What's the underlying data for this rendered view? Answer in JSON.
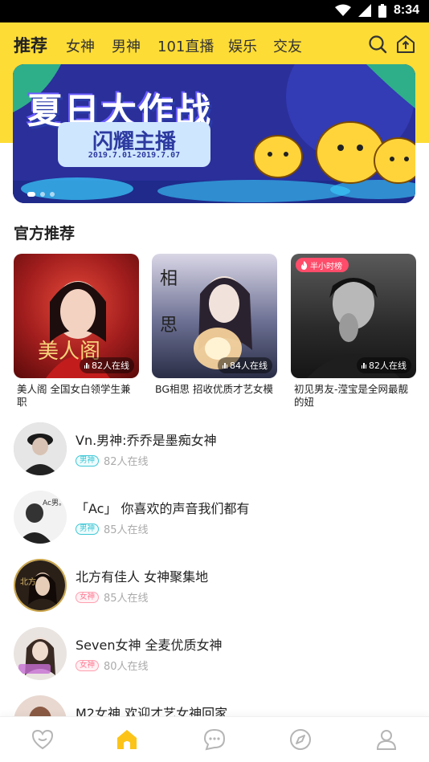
{
  "status_bar": {
    "time": "8:34"
  },
  "top_nav": {
    "tabs": [
      {
        "label": "推荐",
        "active": true
      },
      {
        "label": "女神",
        "active": false
      },
      {
        "label": "男神",
        "active": false
      },
      {
        "label": "101直播",
        "active": false
      },
      {
        "label": "娱乐",
        "active": false
      },
      {
        "label": "交友",
        "active": false
      }
    ],
    "icons": [
      "search-icon",
      "home-upload-icon"
    ]
  },
  "banner": {
    "title": "夏日大作战",
    "subtitle": "闪耀主播",
    "date_range": "2019.7.01-2019.7.07"
  },
  "official": {
    "title": "官方推荐",
    "cards": [
      {
        "title": "美人阁  全国女白领学生兼职",
        "online": "82人在线",
        "badge": ""
      },
      {
        "title": "BG相思   招收优质才艺女模",
        "online": "84人在线",
        "badge": ""
      },
      {
        "title": "初见男友-滢宝是全网最靓的妞",
        "online": "82人在线",
        "badge": "半小时榜"
      }
    ]
  },
  "rooms": [
    {
      "title": "Vn.男神:乔乔是墨痴女神",
      "tag": "男神",
      "online": "82人在线"
    },
    {
      "title": "「Ac」   你喜欢的声音我们都有",
      "tag": "男神",
      "online": "85人在线"
    },
    {
      "title": "北方有佳人    女神聚集地",
      "tag": "女神",
      "online": "85人在线"
    },
    {
      "title": "Seven女神 全麦优质女神",
      "tag": "女神",
      "online": "80人在线"
    },
    {
      "title": "M2女神    欢迎才艺女神回家",
      "tag": "",
      "online": ""
    }
  ],
  "bottom_nav": {
    "items": [
      "heart-icon",
      "home-icon",
      "chat-icon",
      "compass-icon",
      "profile-icon"
    ],
    "active_index": 1
  },
  "colors": {
    "accent": "#fddc35",
    "male_tag": "#3ec7d6",
    "female_tag": "#ff7a93",
    "hot_badge": "#ff4c6a"
  }
}
